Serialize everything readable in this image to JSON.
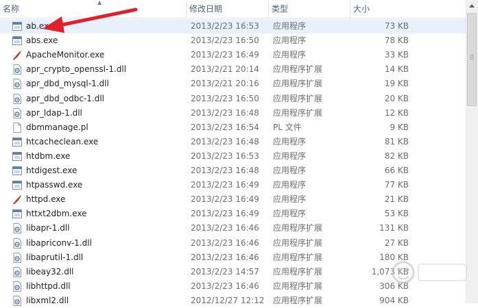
{
  "columns": {
    "name": "名称",
    "date": "修改日期",
    "type": "类型",
    "size": "大小"
  },
  "files": [
    {
      "name": "ab.exe",
      "date": "2013/2/23 16:53",
      "type": "应用程序",
      "size": "73 KB",
      "icon": "exe-window-icon"
    },
    {
      "name": "abs.exe",
      "date": "2013/2/23 16:50",
      "type": "应用程序",
      "size": "78 KB",
      "icon": "exe-window-icon"
    },
    {
      "name": "ApacheMonitor.exe",
      "date": "2013/2/23 16:49",
      "type": "应用程序",
      "size": "33 KB",
      "icon": "apache-feather-monitor-icon"
    },
    {
      "name": "apr_crypto_openssl-1.dll",
      "date": "2013/2/21 20:14",
      "type": "应用程序扩展",
      "size": "14 KB",
      "icon": "dll-gear-icon"
    },
    {
      "name": "apr_dbd_mysql-1.dll",
      "date": "2013/2/21 20:16",
      "type": "应用程序扩展",
      "size": "19 KB",
      "icon": "dll-gear-icon"
    },
    {
      "name": "apr_dbd_odbc-1.dll",
      "date": "2013/2/23 16:50",
      "type": "应用程序扩展",
      "size": "20 KB",
      "icon": "dll-gear-icon"
    },
    {
      "name": "apr_ldap-1.dll",
      "date": "2013/2/23 16:48",
      "type": "应用程序扩展",
      "size": "12 KB",
      "icon": "dll-gear-icon"
    },
    {
      "name": "dbmmanage.pl",
      "date": "2013/2/23 16:54",
      "type": "PL 文件",
      "size": "9 KB",
      "icon": "blank-file-icon"
    },
    {
      "name": "htcacheclean.exe",
      "date": "2013/2/23 16:48",
      "type": "应用程序",
      "size": "81 KB",
      "icon": "exe-window-icon"
    },
    {
      "name": "htdbm.exe",
      "date": "2013/2/23 16:53",
      "type": "应用程序",
      "size": "82 KB",
      "icon": "exe-window-icon"
    },
    {
      "name": "htdigest.exe",
      "date": "2013/2/23 16:48",
      "type": "应用程序",
      "size": "66 KB",
      "icon": "exe-window-icon"
    },
    {
      "name": "htpasswd.exe",
      "date": "2013/2/23 16:49",
      "type": "应用程序",
      "size": "77 KB",
      "icon": "exe-window-icon"
    },
    {
      "name": "httpd.exe",
      "date": "2013/2/23 16:49",
      "type": "应用程序",
      "size": "21 KB",
      "icon": "apache-feather-icon"
    },
    {
      "name": "httxt2dbm.exe",
      "date": "2013/2/23 16:49",
      "type": "应用程序",
      "size": "53 KB",
      "icon": "exe-window-icon"
    },
    {
      "name": "libapr-1.dll",
      "date": "2013/2/23 16:46",
      "type": "应用程序扩展",
      "size": "131 KB",
      "icon": "dll-gear-icon"
    },
    {
      "name": "libapriconv-1.dll",
      "date": "2013/2/23 16:46",
      "type": "应用程序扩展",
      "size": "27 KB",
      "icon": "dll-gear-icon"
    },
    {
      "name": "libaprutil-1.dll",
      "date": "2013/2/23 16:46",
      "type": "应用程序扩展",
      "size": "180 KB",
      "icon": "dll-gear-icon"
    },
    {
      "name": "libeay32.dll",
      "date": "2013/2/23 14:57",
      "type": "应用程序扩展",
      "size": "1,073 KB",
      "icon": "dll-gear-icon"
    },
    {
      "name": "libhttpd.dll",
      "date": "2013/2/23 16:46",
      "type": "应用程序扩展",
      "size": "306 KB",
      "icon": "dll-gear-icon"
    },
    {
      "name": "libxml2.dll",
      "date": "2012/12/27 12:12",
      "type": "应用程序扩展",
      "size": "904 KB",
      "icon": "dll-gear-icon"
    }
  ],
  "colors": {
    "arrow": "#e0202a",
    "header_text": "#4c607a",
    "selected_row": "#e8f1fb"
  }
}
